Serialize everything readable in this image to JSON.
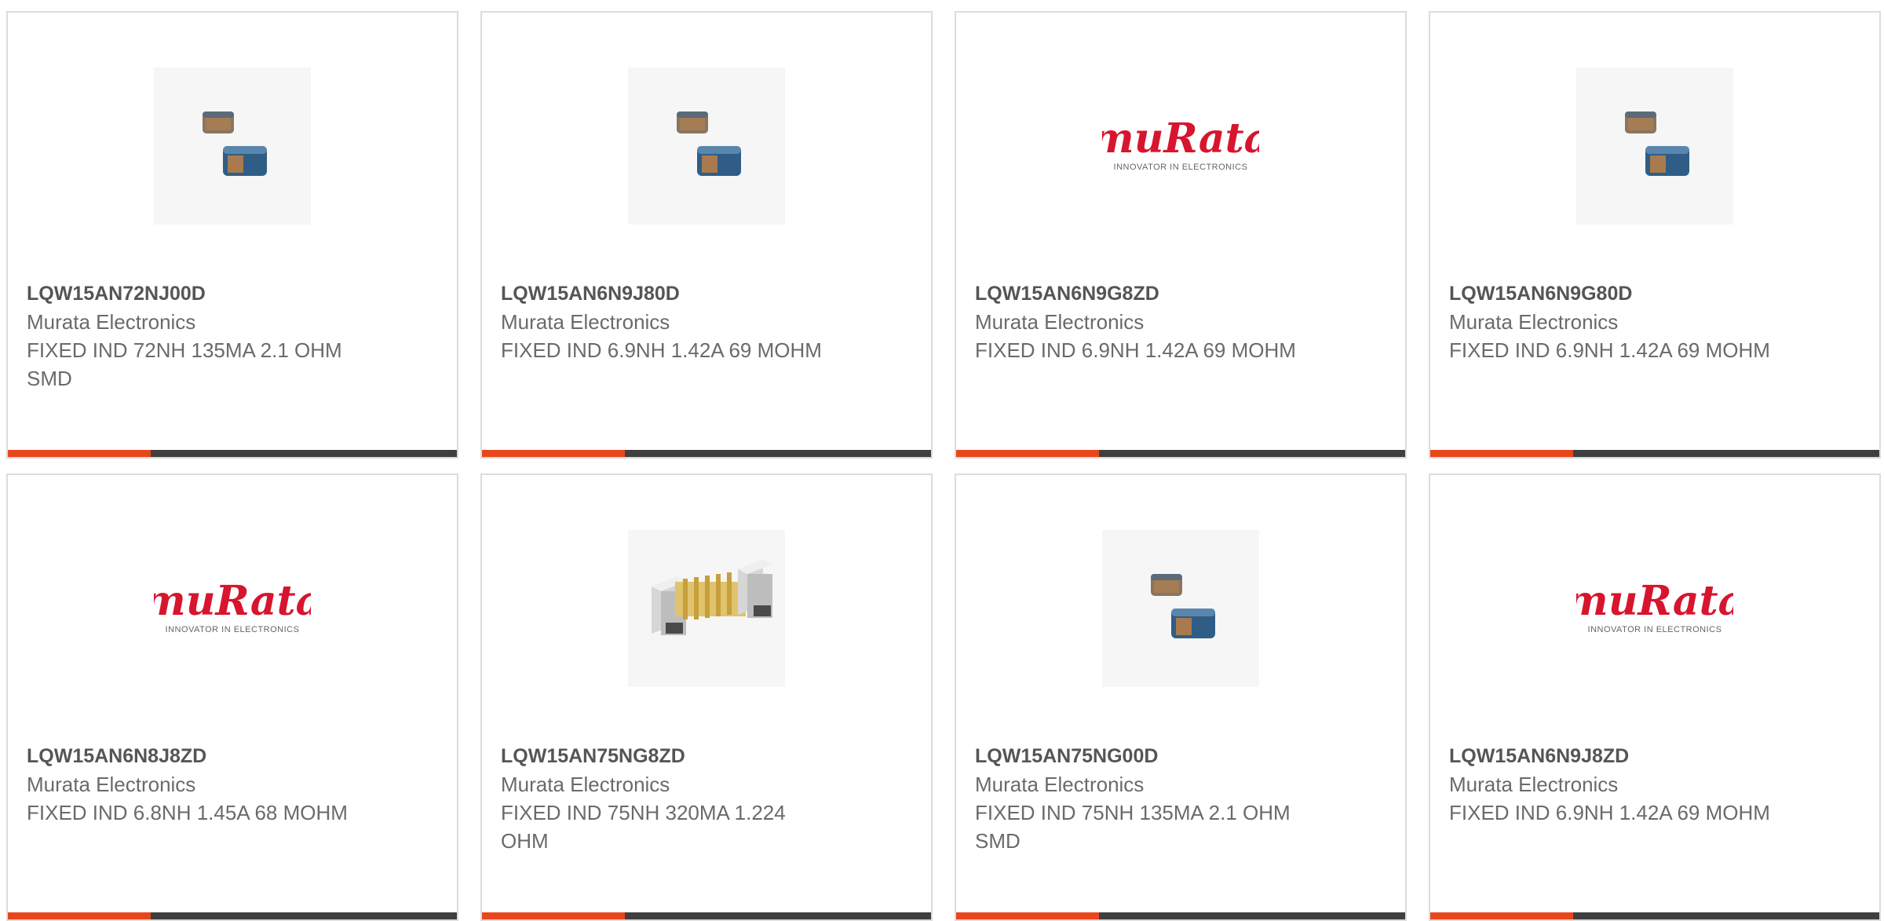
{
  "products": [
    {
      "image": "inductor-pair-image",
      "part_number": "LQW15AN72NJ00D",
      "manufacturer": "Murata Electronics",
      "description": "FIXED IND 72NH 135MA 2.1 OHM SMD"
    },
    {
      "image": "inductor-pair-image",
      "part_number": "LQW15AN6N9J80D",
      "manufacturer": "Murata Electronics",
      "description": "FIXED IND 6.9NH 1.42A 69 MOHM"
    },
    {
      "image": "murata-logo",
      "logo_text": "muRata",
      "logo_tagline": "INNOVATOR IN ELECTRONICS",
      "part_number": "LQW15AN6N9G8ZD",
      "manufacturer": "Murata Electronics",
      "description": "FIXED IND 6.9NH 1.42A 69 MOHM"
    },
    {
      "image": "inductor-pair-image",
      "part_number": "LQW15AN6N9G80D",
      "manufacturer": "Murata Electronics",
      "description": "FIXED IND 6.9NH 1.42A 69 MOHM"
    },
    {
      "image": "murata-logo",
      "logo_text": "muRata",
      "logo_tagline": "INNOVATOR IN ELECTRONICS",
      "part_number": "LQW15AN6N8J8ZD",
      "manufacturer": "Murata Electronics",
      "description": "FIXED IND 6.8NH 1.45A 68 MOHM"
    },
    {
      "image": "wirewound-coil-image",
      "part_number": "LQW15AN75NG8ZD",
      "manufacturer": "Murata Electronics",
      "description": "FIXED IND 75NH 320MA 1.224 OHM"
    },
    {
      "image": "inductor-pair-image",
      "part_number": "LQW15AN75NG00D",
      "manufacturer": "Murata Electronics",
      "description": "FIXED IND 75NH 135MA 2.1 OHM SMD"
    },
    {
      "image": "murata-logo",
      "logo_text": "muRata",
      "logo_tagline": "INNOVATOR IN ELECTRONICS",
      "part_number": "LQW15AN6N9J8ZD",
      "manufacturer": "Murata Electronics",
      "description": "FIXED IND 6.9NH 1.42A 69 MOHM"
    }
  ],
  "colors": {
    "accent": "#e8471c",
    "bar": "#3f3f3f",
    "logo_red": "#d7152e"
  }
}
